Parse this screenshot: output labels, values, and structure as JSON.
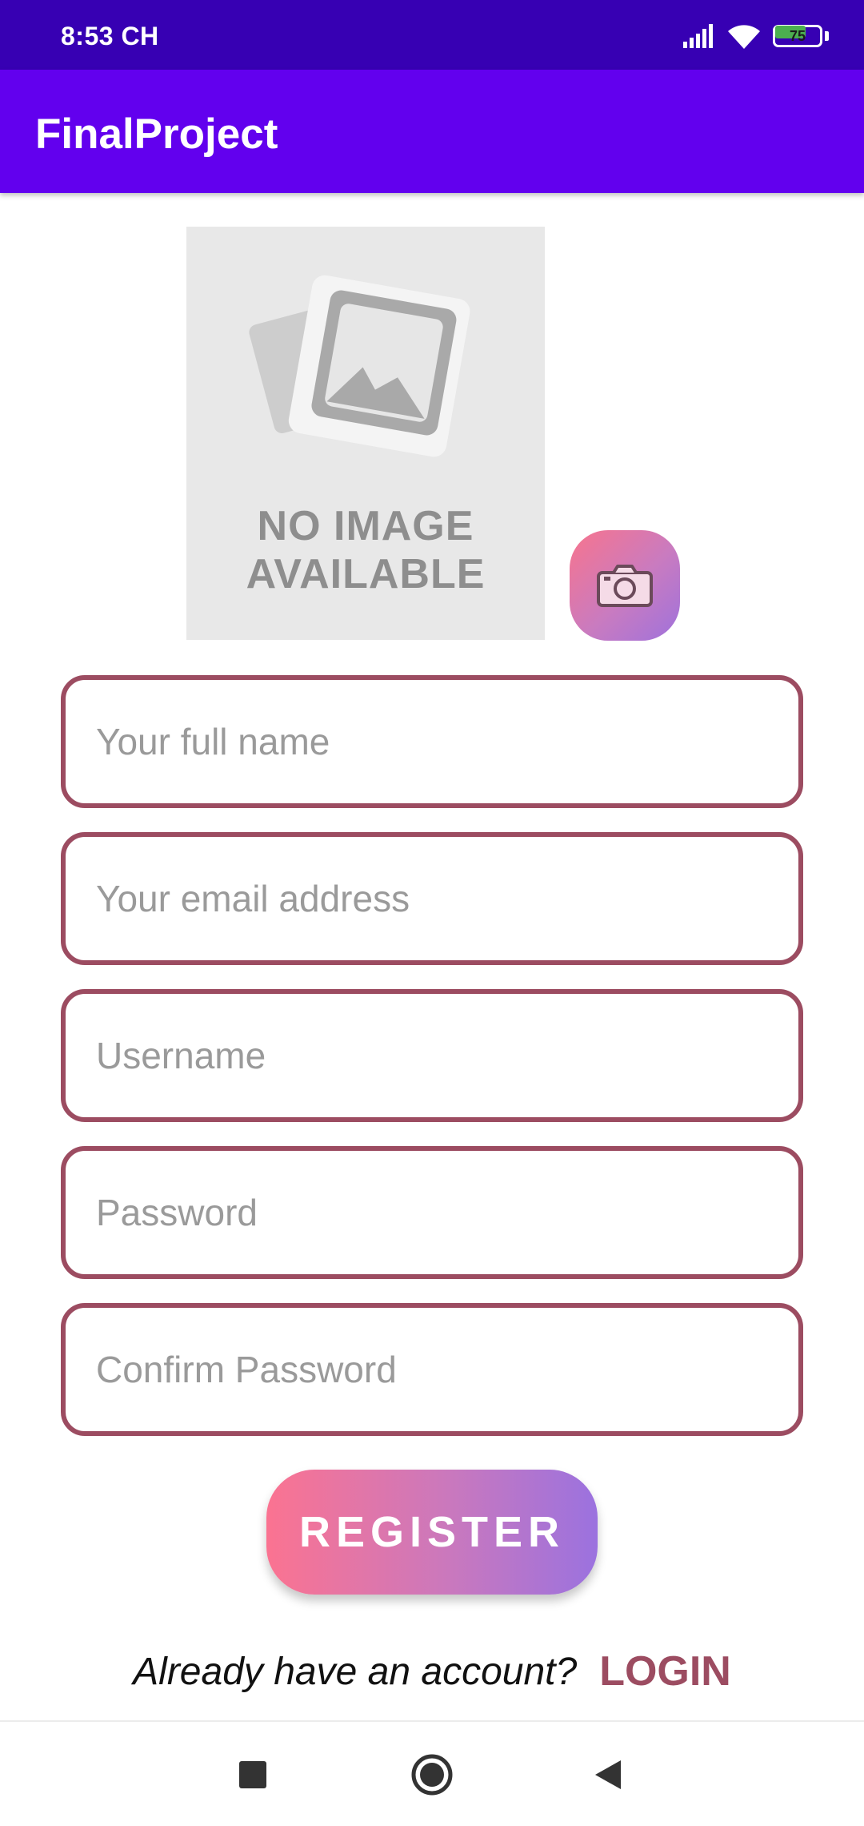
{
  "status_bar": {
    "time": "8:53 CH",
    "battery_level": "75",
    "battery_fraction": 0.75,
    "icons": [
      "signal-icon",
      "wifi-icon",
      "battery-icon"
    ]
  },
  "app_bar": {
    "title": "FinalProject"
  },
  "image_placeholder": {
    "text_line1": "NO IMAGE",
    "text_line2": "AVAILABLE",
    "camera_icon": "camera-icon"
  },
  "form": {
    "full_name_placeholder": "Your full name",
    "email_placeholder": "Your email address",
    "username_placeholder": "Username",
    "password_placeholder": "Password",
    "confirm_password_placeholder": "Confirm Password"
  },
  "register_label": "REGISTER",
  "login_prompt": "Already have an account?",
  "login_label": "LOGIN",
  "colors": {
    "status_bar": "#3700b3",
    "app_bar": "#6200ee",
    "field_border": "#9c4c61",
    "gradient_start": "#fb7391",
    "gradient_end": "#9b72df"
  },
  "nav_bar": {
    "icons": [
      "recents-icon",
      "home-icon",
      "back-icon"
    ]
  }
}
